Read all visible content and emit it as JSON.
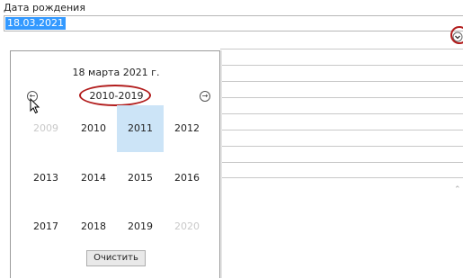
{
  "field": {
    "label": "Дата рождения",
    "value": "18.03.2021"
  },
  "dropdown": {
    "icon": "chevron-down-circle-icon"
  },
  "calendar": {
    "today_label": "18 марта 2021 г.",
    "decade_label": "2010-2019",
    "prev_icon": "arrow-left-circle-icon",
    "next_icon": "arrow-right-circle-icon",
    "years": [
      {
        "label": "2009",
        "state": "outside"
      },
      {
        "label": "2010",
        "state": "normal"
      },
      {
        "label": "2011",
        "state": "selected"
      },
      {
        "label": "2012",
        "state": "normal"
      },
      {
        "label": "2013",
        "state": "normal"
      },
      {
        "label": "2014",
        "state": "normal"
      },
      {
        "label": "2015",
        "state": "normal"
      },
      {
        "label": "2016",
        "state": "normal"
      },
      {
        "label": "2017",
        "state": "normal"
      },
      {
        "label": "2018",
        "state": "normal"
      },
      {
        "label": "2019",
        "state": "normal"
      },
      {
        "label": "2020",
        "state": "outside"
      }
    ],
    "clear_label": "Очистить"
  },
  "colors": {
    "selection": "#3399ff",
    "selected_year": "#cce4f7",
    "highlight_ring": "#b21d1d"
  }
}
